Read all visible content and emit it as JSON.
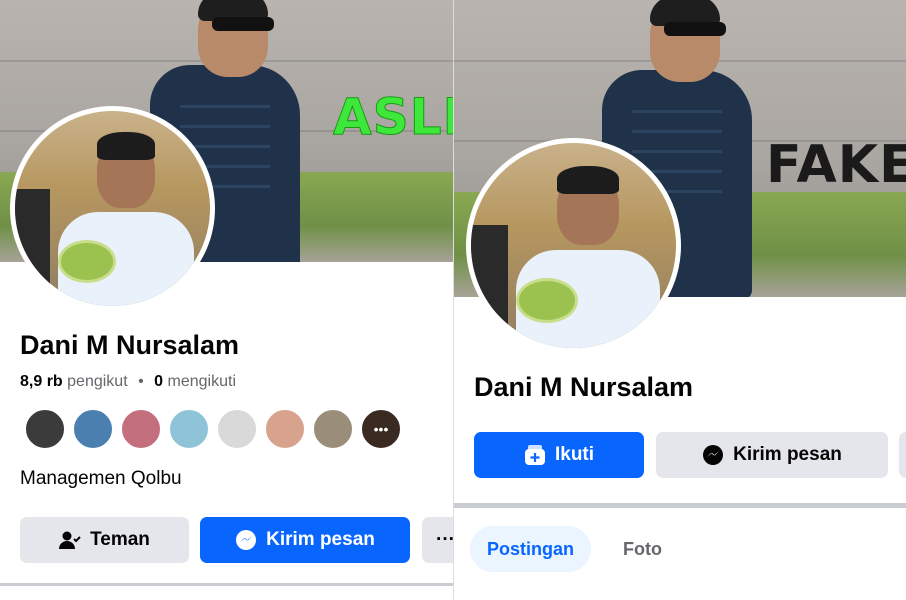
{
  "left": {
    "stamp": "ASLI",
    "name": "Dani M Nursalam",
    "stats": {
      "followers_count": "8,9 rb",
      "followers_label": "pengikut",
      "separator": "•",
      "following_count": "0",
      "following_label": "mengikuti"
    },
    "friend_avatars": [
      "#3b3b3b",
      "#4a7fb0",
      "#c46f7e",
      "#8fc4d8",
      "#d9d9d9",
      "#d7a38c",
      "#9a8e7b",
      "#3a2a22"
    ],
    "bio": "Managemen Qolbu",
    "buttons": {
      "friends": "Teman",
      "message": "Kirim pesan",
      "more": "···"
    }
  },
  "right": {
    "stamp": "FAKE",
    "name": "Dani M Nursalam",
    "buttons": {
      "follow": "Ikuti",
      "message": "Kirim pesan"
    },
    "tabs": [
      "Postingan",
      "Foto"
    ]
  },
  "colors": {
    "accent": "#0866ff",
    "grey_button": "#e4e6eb",
    "asli_stamp": "#3ee83a",
    "fake_stamp": "#1a1a1a"
  }
}
